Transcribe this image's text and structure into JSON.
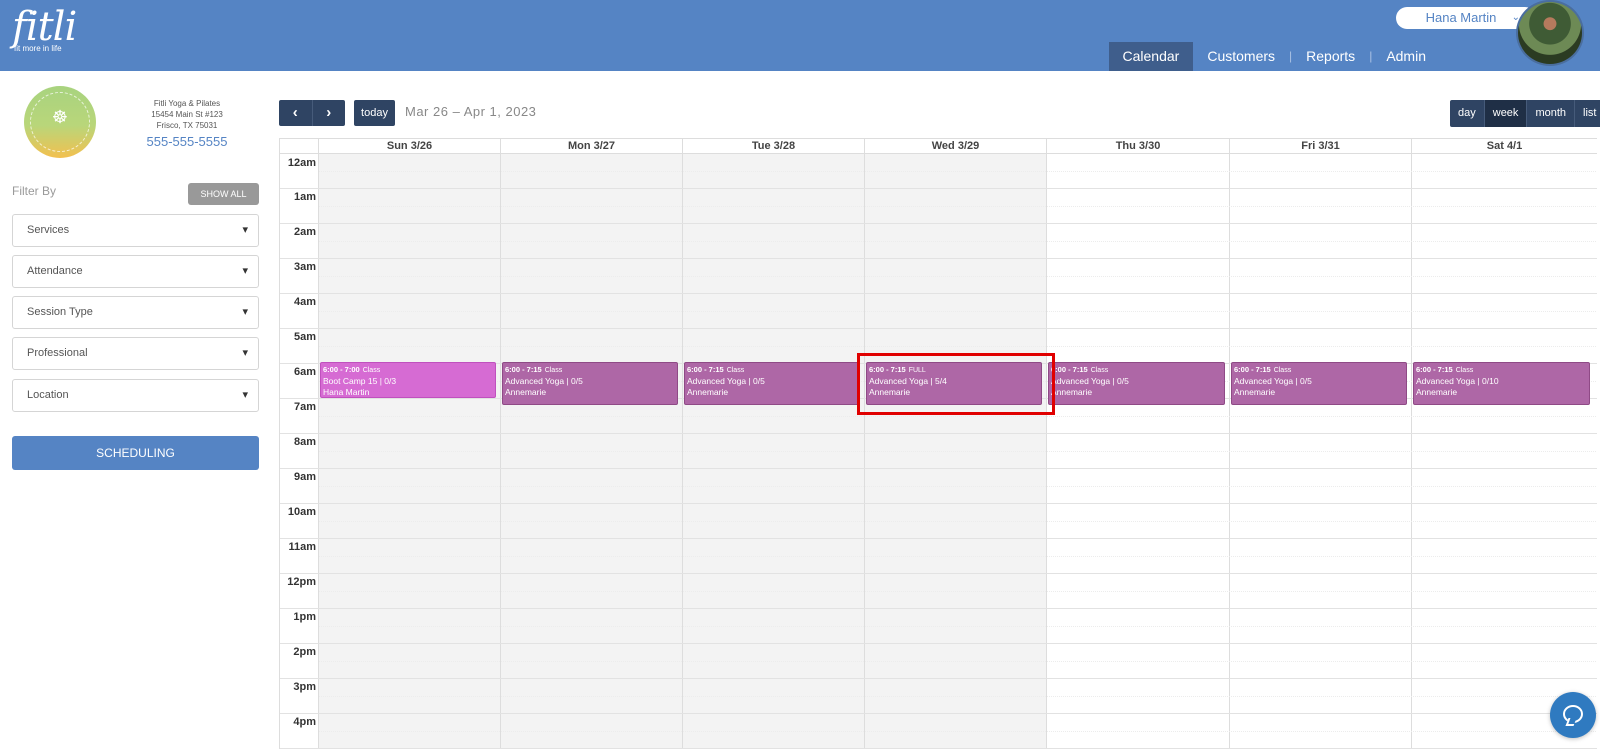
{
  "header": {
    "logo_text": "fitli",
    "logo_tagline": "fit more in life",
    "user_name": "Hana Martin",
    "nav": [
      {
        "label": "Calendar",
        "active": true
      },
      {
        "label": "Customers",
        "active": false
      },
      {
        "label": "Reports",
        "active": false
      },
      {
        "label": "Admin",
        "active": false
      }
    ],
    "colors": {
      "header_bg": "#5584c4",
      "active_tab": "#3f5e8c"
    }
  },
  "sidebar": {
    "studio_name": "Fitli Yoga & Pilates",
    "address_line1": "15454 Main St #123",
    "address_line2": "Frisco, TX 75031",
    "phone": "555-555-5555",
    "filter_label": "Filter By",
    "show_all_label": "SHOW ALL",
    "filters": [
      "Services",
      "Attendance",
      "Session Type",
      "Professional",
      "Location"
    ],
    "scheduling_label": "SCHEDULING"
  },
  "toolbar": {
    "prev_icon": "‹",
    "next_icon": "›",
    "today_label": "today",
    "date_range": "Mar 26 – Apr 1, 2023",
    "views": [
      {
        "label": "day",
        "active": false
      },
      {
        "label": "week",
        "active": true
      },
      {
        "label": "month",
        "active": false
      },
      {
        "label": "list",
        "active": false
      }
    ]
  },
  "calendar": {
    "days": [
      "Sun 3/26",
      "Mon 3/27",
      "Tue 3/28",
      "Wed 3/29",
      "Thu 3/30",
      "Fri 3/31",
      "Sat 4/1"
    ],
    "hours": [
      "12am",
      "1am",
      "2am",
      "3am",
      "4am",
      "5am",
      "6am",
      "7am",
      "8am",
      "9am",
      "10am",
      "11am",
      "12pm",
      "1pm",
      "2pm",
      "3pm",
      "4pm"
    ],
    "events": [
      {
        "time": "6:00 - 7:00",
        "kind": "Class",
        "title": "Boot Camp 15 | 0/3",
        "instructor": "Hana Martin"
      },
      {
        "time": "6:00 - 7:15",
        "kind": "Class",
        "title": "Advanced Yoga | 0/5",
        "instructor": "Annemarie"
      },
      {
        "time": "6:00 - 7:15",
        "kind": "Class",
        "title": "Advanced Yoga | 0/5",
        "instructor": "Annemarie"
      },
      {
        "time": "6:00 - 7:15",
        "kind": "FULL",
        "title": "Advanced Yoga | 5/4",
        "instructor": "Annemarie"
      },
      {
        "time": "6:00 - 7:15",
        "kind": "Class",
        "title": "Advanced Yoga | 0/5",
        "instructor": "Annemarie"
      },
      {
        "time": "6:00 - 7:15",
        "kind": "Class",
        "title": "Advanced Yoga | 0/5",
        "instructor": "Annemarie"
      },
      {
        "time": "6:00 - 7:15",
        "kind": "Class",
        "title": "Advanced Yoga | 0/10",
        "instructor": "Annemarie"
      }
    ],
    "colors": {
      "boot_camp": "#d66bd3",
      "yoga": "#ae67a6",
      "past_day_bg": "#f3f3f3",
      "highlight": "#e00000"
    }
  },
  "chat_icon": "chat-bubble-icon"
}
